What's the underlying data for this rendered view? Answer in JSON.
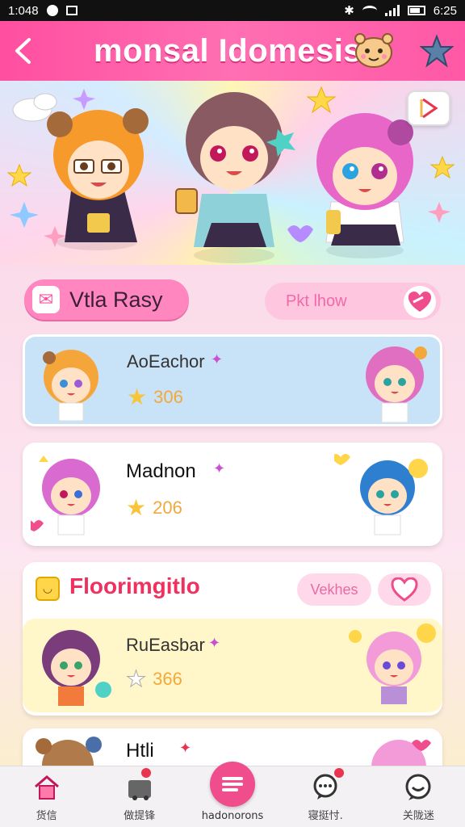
{
  "status_bar": {
    "time": "1:048",
    "right_time": "6:25"
  },
  "header": {
    "back_icon": "chevron-left-icon",
    "title": "monsal Idomesis"
  },
  "hero": {
    "play_icon": "play-icon"
  },
  "section": {
    "primary_chip_label": "Vtla Rasy",
    "primary_chip_icon": "mail-icon",
    "secondary_chip_label": "Pkt lhow",
    "secondary_chip_icon": "heart-icon"
  },
  "cards": [
    {
      "name": "AoEachor",
      "score": "306"
    },
    {
      "name": "Madnon",
      "score": "206"
    }
  ],
  "group": {
    "title": "Floorimgitlo",
    "vote_label": "Vekhes",
    "item": {
      "name": "RuEasbar",
      "score": "366"
    }
  },
  "partial_card": {
    "name": "Htli"
  },
  "nav": [
    {
      "label": "货信",
      "icon": "home-icon"
    },
    {
      "label": "做提锋",
      "icon": "shop-icon"
    },
    {
      "label": "hadonorons",
      "icon": "menu-icon"
    },
    {
      "label": "寝挺忖.",
      "icon": "chat-bubble-icon"
    },
    {
      "label": "关陇迷",
      "icon": "message-icon"
    }
  ],
  "colors": {
    "accent": "#ff4fa0",
    "header": "#ff6fb2",
    "star": "#f8c43a"
  }
}
